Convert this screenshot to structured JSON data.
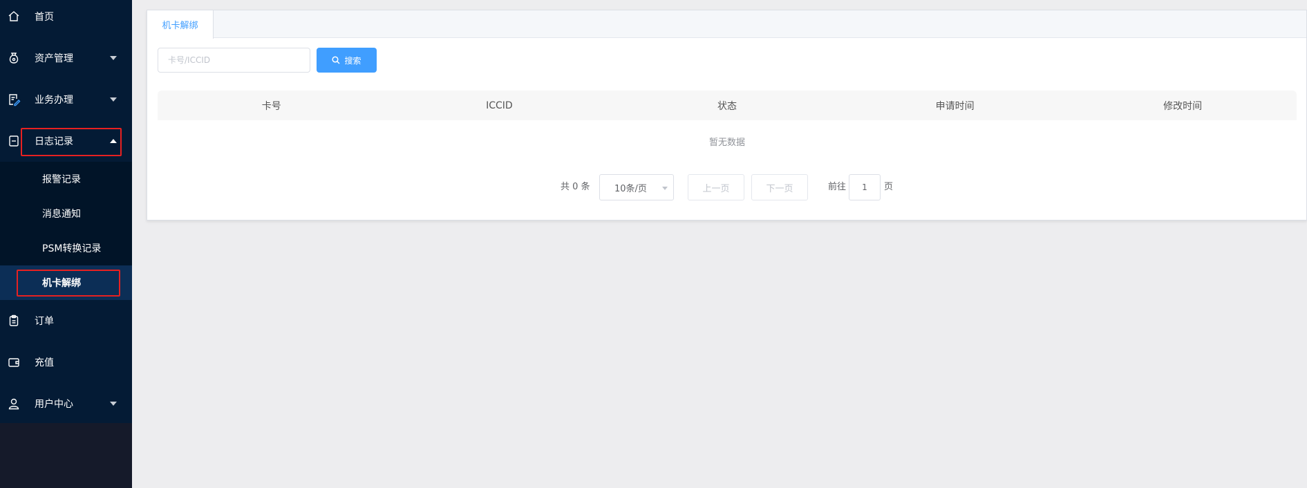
{
  "sidebar": {
    "items": [
      {
        "label": "首页",
        "icon": "home-icon"
      },
      {
        "label": "资产管理",
        "icon": "money-bag-icon"
      },
      {
        "label": "业务办理",
        "icon": "edit-document-icon"
      },
      {
        "label": "日志记录",
        "icon": "log-document-icon",
        "expanded": true
      },
      {
        "label": "订单",
        "icon": "clipboard-icon"
      },
      {
        "label": "充值",
        "icon": "wallet-icon"
      },
      {
        "label": "用户中心",
        "icon": "user-icon"
      }
    ],
    "log_subitems": [
      {
        "label": "报警记录"
      },
      {
        "label": "消息通知"
      },
      {
        "label": "PSM转换记录"
      },
      {
        "label": "机卡解绑",
        "active": true
      }
    ]
  },
  "tabs": [
    {
      "label": "机卡解绑",
      "active": true
    }
  ],
  "search": {
    "placeholder": "卡号/ICCID",
    "value": "",
    "button_label": "搜索"
  },
  "table": {
    "columns": [
      "卡号",
      "ICCID",
      "状态",
      "申请时间",
      "修改时间"
    ],
    "rows": [],
    "empty_text": "暂无数据"
  },
  "pagination": {
    "total_text": "共 0 条",
    "page_size": "10条/页",
    "prev_label": "上一页",
    "next_label": "下一页",
    "goto_label": "前往",
    "current_page": "1",
    "page_unit": "页"
  },
  "colors": {
    "sidebar_bg": "#041b35",
    "submenu_bg": "#011428",
    "submenu_active_bg": "#0c2e56",
    "accent": "#409eff",
    "highlight_box": "#e82121",
    "content_bg": "#ededef"
  }
}
